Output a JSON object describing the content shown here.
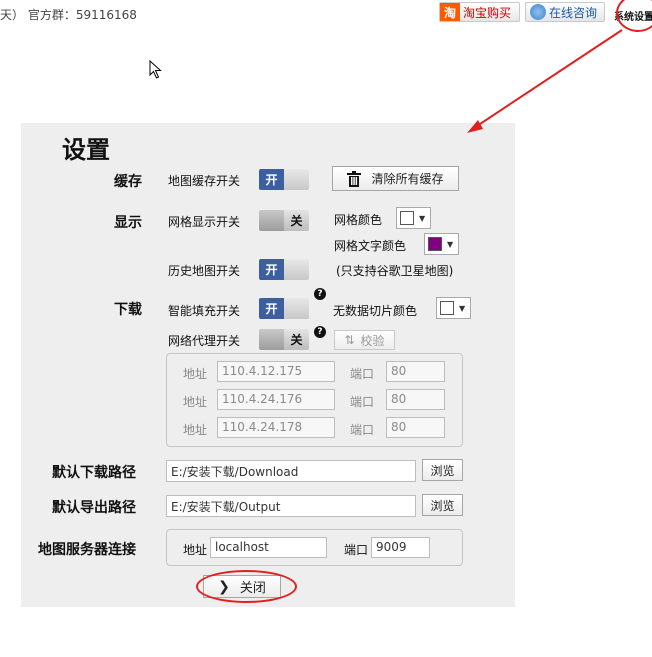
{
  "header": {
    "left_text": "天）  官方群：59116168",
    "taobao_icon": "淘",
    "taobao_label": "淘宝购买",
    "consult_label": "在线咨询",
    "system_settings": "系统设置"
  },
  "dialog": {
    "title": "设置",
    "cache": {
      "section": "缓存",
      "map_cache_label": "地图缓存开关",
      "map_cache_state": "开",
      "clear_all_label": "清除所有缓存"
    },
    "display": {
      "section": "显示",
      "grid_label": "网格显示开关",
      "grid_state": "关",
      "grid_color_label": "网格颜色",
      "grid_color": "#ffffff",
      "grid_text_color_label": "网格文字颜色",
      "grid_text_color": "#800080",
      "history_label": "历史地图开关",
      "history_state": "开",
      "history_note": "(只支持谷歌卫星地图)"
    },
    "download": {
      "section": "下载",
      "smart_fill_label": "智能填充开关",
      "smart_fill_state": "开",
      "no_data_color_label": "无数据切片颜色",
      "no_data_color": "#ffffff",
      "proxy_label": "网络代理开关",
      "proxy_state": "关",
      "verify_label": "校验",
      "proxies": [
        {
          "addr_label": "地址",
          "addr": "110.4.12.175",
          "port_label": "端口",
          "port": "80"
        },
        {
          "addr_label": "地址",
          "addr": "110.4.24.176",
          "port_label": "端口",
          "port": "80"
        },
        {
          "addr_label": "地址",
          "addr": "110.4.24.178",
          "port_label": "端口",
          "port": "80"
        }
      ]
    },
    "paths": {
      "download_label": "默认下载路径",
      "download_path": "E:/安装下载/Download",
      "export_label": "默认导出路径",
      "export_path": "E:/安装下载/Output",
      "browse_label": "浏览"
    },
    "server": {
      "label": "地图服务器连接",
      "addr_label": "地址",
      "addr": "localhost",
      "port_label": "端口",
      "port": "9009"
    },
    "close_label": "关闭"
  },
  "accent": {
    "toggle_on": "#3c5f9e",
    "annotation": "#e02020"
  }
}
